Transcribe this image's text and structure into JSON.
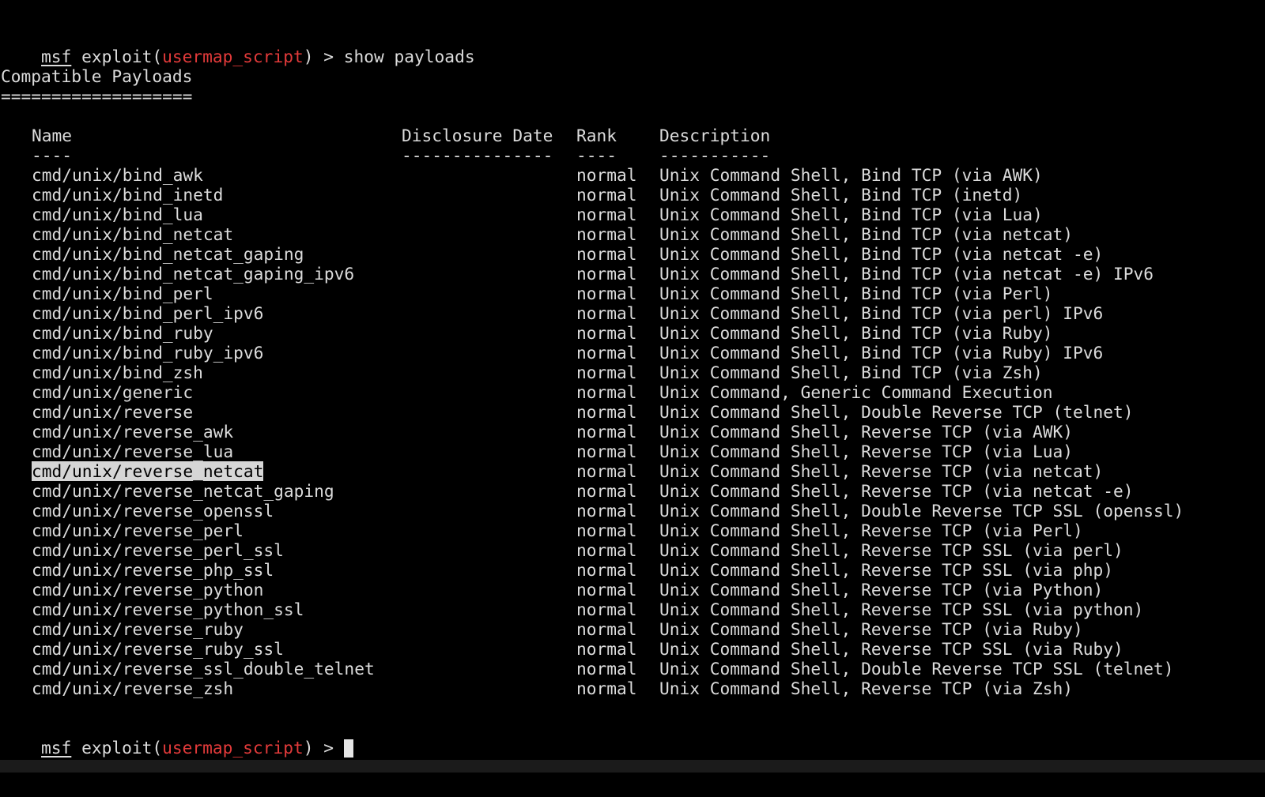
{
  "prompt": {
    "msf": "msf",
    "exploit_prefix": " exploit(",
    "module": "usermap_script",
    "suffix": ") > ",
    "command": "show payloads"
  },
  "section": {
    "title": "Compatible Payloads",
    "underline": "==================="
  },
  "table": {
    "headers": {
      "name": "Name",
      "date": "Disclosure Date",
      "rank": "Rank",
      "desc": "Description"
    },
    "separators": {
      "name": "----",
      "date": "---------------",
      "rank": "----",
      "desc": "-----------"
    },
    "rows": [
      {
        "name": "cmd/unix/bind_awk",
        "date": "",
        "rank": "normal",
        "desc": "Unix Command Shell, Bind TCP (via AWK)"
      },
      {
        "name": "cmd/unix/bind_inetd",
        "date": "",
        "rank": "normal",
        "desc": "Unix Command Shell, Bind TCP (inetd)"
      },
      {
        "name": "cmd/unix/bind_lua",
        "date": "",
        "rank": "normal",
        "desc": "Unix Command Shell, Bind TCP (via Lua)"
      },
      {
        "name": "cmd/unix/bind_netcat",
        "date": "",
        "rank": "normal",
        "desc": "Unix Command Shell, Bind TCP (via netcat)"
      },
      {
        "name": "cmd/unix/bind_netcat_gaping",
        "date": "",
        "rank": "normal",
        "desc": "Unix Command Shell, Bind TCP (via netcat -e)"
      },
      {
        "name": "cmd/unix/bind_netcat_gaping_ipv6",
        "date": "",
        "rank": "normal",
        "desc": "Unix Command Shell, Bind TCP (via netcat -e) IPv6"
      },
      {
        "name": "cmd/unix/bind_perl",
        "date": "",
        "rank": "normal",
        "desc": "Unix Command Shell, Bind TCP (via Perl)"
      },
      {
        "name": "cmd/unix/bind_perl_ipv6",
        "date": "",
        "rank": "normal",
        "desc": "Unix Command Shell, Bind TCP (via perl) IPv6"
      },
      {
        "name": "cmd/unix/bind_ruby",
        "date": "",
        "rank": "normal",
        "desc": "Unix Command Shell, Bind TCP (via Ruby)"
      },
      {
        "name": "cmd/unix/bind_ruby_ipv6",
        "date": "",
        "rank": "normal",
        "desc": "Unix Command Shell, Bind TCP (via Ruby) IPv6"
      },
      {
        "name": "cmd/unix/bind_zsh",
        "date": "",
        "rank": "normal",
        "desc": "Unix Command Shell, Bind TCP (via Zsh)"
      },
      {
        "name": "cmd/unix/generic",
        "date": "",
        "rank": "normal",
        "desc": "Unix Command, Generic Command Execution"
      },
      {
        "name": "cmd/unix/reverse",
        "date": "",
        "rank": "normal",
        "desc": "Unix Command Shell, Double Reverse TCP (telnet)"
      },
      {
        "name": "cmd/unix/reverse_awk",
        "date": "",
        "rank": "normal",
        "desc": "Unix Command Shell, Reverse TCP (via AWK)"
      },
      {
        "name": "cmd/unix/reverse_lua",
        "date": "",
        "rank": "normal",
        "desc": "Unix Command Shell, Reverse TCP (via Lua)"
      },
      {
        "name": "cmd/unix/reverse_netcat",
        "date": "",
        "rank": "normal",
        "desc": "Unix Command Shell, Reverse TCP (via netcat)",
        "selected": true
      },
      {
        "name": "cmd/unix/reverse_netcat_gaping",
        "date": "",
        "rank": "normal",
        "desc": "Unix Command Shell, Reverse TCP (via netcat -e)"
      },
      {
        "name": "cmd/unix/reverse_openssl",
        "date": "",
        "rank": "normal",
        "desc": "Unix Command Shell, Double Reverse TCP SSL (openssl)"
      },
      {
        "name": "cmd/unix/reverse_perl",
        "date": "",
        "rank": "normal",
        "desc": "Unix Command Shell, Reverse TCP (via Perl)"
      },
      {
        "name": "cmd/unix/reverse_perl_ssl",
        "date": "",
        "rank": "normal",
        "desc": "Unix Command Shell, Reverse TCP SSL (via perl)"
      },
      {
        "name": "cmd/unix/reverse_php_ssl",
        "date": "",
        "rank": "normal",
        "desc": "Unix Command Shell, Reverse TCP SSL (via php)"
      },
      {
        "name": "cmd/unix/reverse_python",
        "date": "",
        "rank": "normal",
        "desc": "Unix Command Shell, Reverse TCP (via Python)"
      },
      {
        "name": "cmd/unix/reverse_python_ssl",
        "date": "",
        "rank": "normal",
        "desc": "Unix Command Shell, Reverse TCP SSL (via python)"
      },
      {
        "name": "cmd/unix/reverse_ruby",
        "date": "",
        "rank": "normal",
        "desc": "Unix Command Shell, Reverse TCP (via Ruby)"
      },
      {
        "name": "cmd/unix/reverse_ruby_ssl",
        "date": "",
        "rank": "normal",
        "desc": "Unix Command Shell, Reverse TCP SSL (via Ruby)"
      },
      {
        "name": "cmd/unix/reverse_ssl_double_telnet",
        "date": "",
        "rank": "normal",
        "desc": "Unix Command Shell, Double Reverse TCP SSL (telnet)"
      },
      {
        "name": "cmd/unix/reverse_zsh",
        "date": "",
        "rank": "normal",
        "desc": "Unix Command Shell, Reverse TCP (via Zsh)"
      }
    ]
  },
  "prompt2": {
    "msf": "msf",
    "exploit_prefix": " exploit(",
    "module": "usermap_script",
    "suffix": ") > "
  },
  "colors": {
    "background": "#000000",
    "text": "#dcdcdc",
    "module": "#e23a3a",
    "highlight": "#d6d6d6"
  }
}
